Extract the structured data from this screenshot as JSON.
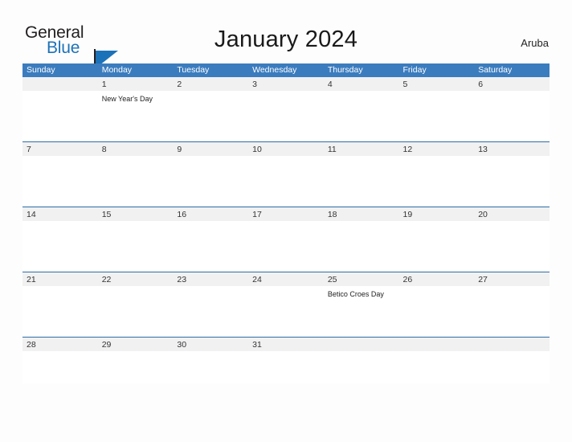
{
  "logo": {
    "word_one": "General",
    "word_two": "Blue",
    "accent_color": "#1c72b8",
    "text_color": "#231f20"
  },
  "header": {
    "title": "January 2024",
    "location": "Aruba"
  },
  "theme": {
    "header_blue": "#3b7cbe",
    "row_border_blue": "#2f6da8",
    "date_strip_gray": "#f1f1f1",
    "page_background": "#fdfdfd"
  },
  "calendar": {
    "month": "January",
    "year": "2024",
    "weekday_headers": [
      "Sunday",
      "Monday",
      "Tuesday",
      "Wednesday",
      "Thursday",
      "Friday",
      "Saturday"
    ],
    "weeks": [
      {
        "days": [
          {
            "date": "",
            "event": ""
          },
          {
            "date": "1",
            "event": "New Year's Day"
          },
          {
            "date": "2",
            "event": ""
          },
          {
            "date": "3",
            "event": ""
          },
          {
            "date": "4",
            "event": ""
          },
          {
            "date": "5",
            "event": ""
          },
          {
            "date": "6",
            "event": ""
          }
        ]
      },
      {
        "days": [
          {
            "date": "7",
            "event": ""
          },
          {
            "date": "8",
            "event": ""
          },
          {
            "date": "9",
            "event": ""
          },
          {
            "date": "10",
            "event": ""
          },
          {
            "date": "11",
            "event": ""
          },
          {
            "date": "12",
            "event": ""
          },
          {
            "date": "13",
            "event": ""
          }
        ]
      },
      {
        "days": [
          {
            "date": "14",
            "event": ""
          },
          {
            "date": "15",
            "event": ""
          },
          {
            "date": "16",
            "event": ""
          },
          {
            "date": "17",
            "event": ""
          },
          {
            "date": "18",
            "event": ""
          },
          {
            "date": "19",
            "event": ""
          },
          {
            "date": "20",
            "event": ""
          }
        ]
      },
      {
        "days": [
          {
            "date": "21",
            "event": ""
          },
          {
            "date": "22",
            "event": ""
          },
          {
            "date": "23",
            "event": ""
          },
          {
            "date": "24",
            "event": ""
          },
          {
            "date": "25",
            "event": "Betico Croes Day"
          },
          {
            "date": "26",
            "event": ""
          },
          {
            "date": "27",
            "event": ""
          }
        ]
      },
      {
        "days": [
          {
            "date": "28",
            "event": ""
          },
          {
            "date": "29",
            "event": ""
          },
          {
            "date": "30",
            "event": ""
          },
          {
            "date": "31",
            "event": ""
          },
          {
            "date": "",
            "event": ""
          },
          {
            "date": "",
            "event": ""
          },
          {
            "date": "",
            "event": ""
          }
        ]
      }
    ]
  }
}
